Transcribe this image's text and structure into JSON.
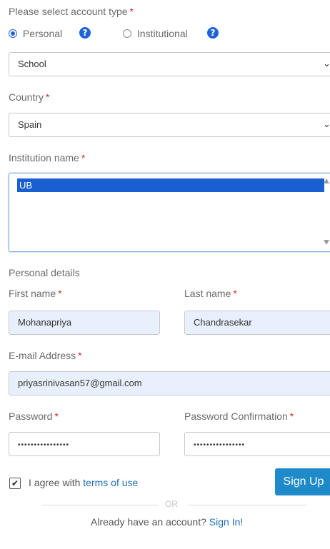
{
  "account_type": {
    "label": "Please select account type",
    "required_mark": "*",
    "options": [
      {
        "label": "Personal",
        "selected": true
      },
      {
        "label": "Institutional",
        "selected": false
      }
    ]
  },
  "institution_type_select": {
    "value": "School"
  },
  "country": {
    "label": "Country",
    "required_mark": "*",
    "value": "Spain"
  },
  "institution_name": {
    "label": "Institution name",
    "required_mark": "*",
    "selected_option": "UB"
  },
  "personal_details": {
    "heading": "Personal details"
  },
  "first_name": {
    "label": "First name",
    "required_mark": "*",
    "value": "Mohanapriya"
  },
  "last_name": {
    "label": "Last name",
    "required_mark": "*",
    "value": "Chandrasekar"
  },
  "email": {
    "label": "E-mail Address",
    "required_mark": "*",
    "value": "priyasrinivasan57@gmail.com"
  },
  "password": {
    "label": "Password",
    "required_mark": "*",
    "masked_value": "••••••••••••••••"
  },
  "password_confirmation": {
    "label": "Password Confirmation",
    "required_mark": "*",
    "masked_value": "••••••••••••••••"
  },
  "terms": {
    "prefix": "I agree with",
    "link_text": "terms of use",
    "checked": true
  },
  "signup_button": {
    "label": "Sign Up"
  },
  "divider": {
    "text": "OR"
  },
  "signin": {
    "prompt": "Already have an account?",
    "link_text": "Sign In!"
  },
  "colors": {
    "accent": "#1f63d9",
    "button": "#1f8ac9",
    "required": "#c9302c",
    "autofill_bg": "#e8f0fe"
  }
}
